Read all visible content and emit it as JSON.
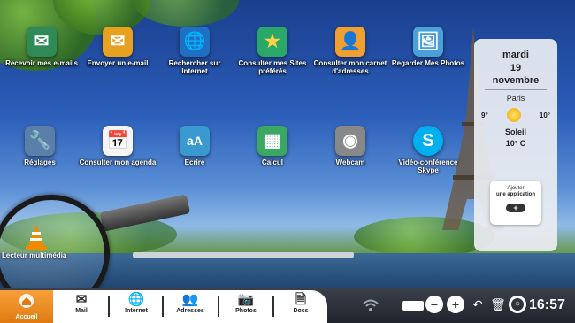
{
  "apps_row1": [
    {
      "label": "Recevoir mes e-mails",
      "icon": "receive-mail-icon",
      "glyph": "✉",
      "color": "#2e8b57"
    },
    {
      "label": "Envoyer un e-mail",
      "icon": "send-mail-icon",
      "glyph": "✉",
      "color": "#e8a020"
    },
    {
      "label": "Rechercher sur Internet",
      "icon": "globe-www-icon",
      "glyph": "🌐",
      "color": "#1f6fc2"
    },
    {
      "label": "Consulter mes Sites préférés",
      "icon": "favorites-globe-icon",
      "glyph": "★",
      "color": "#2aa86a"
    },
    {
      "label": "Consulter mon carnet d'adresses",
      "icon": "address-book-icon",
      "glyph": "👤",
      "color": "#f0a030"
    },
    {
      "label": "Regarder Mes Photos",
      "icon": "photos-icon",
      "glyph": "🖼",
      "color": "#4aa0d8"
    }
  ],
  "apps_row2": [
    {
      "label": "Réglages",
      "icon": "settings-tools-icon",
      "glyph": "🔧",
      "color": "#5a7fa8"
    },
    {
      "label": "Consulter mon agenda",
      "icon": "calendar-icon",
      "glyph": "📅",
      "color": "#d84040"
    },
    {
      "label": "Ecrire",
      "icon": "write-document-icon",
      "glyph": "aA",
      "color": "#3a9ad0"
    },
    {
      "label": "Calcul",
      "icon": "spreadsheet-icon",
      "glyph": "▦",
      "color": "#3aa860"
    },
    {
      "label": "Webcam",
      "icon": "webcam-icon",
      "glyph": "◉",
      "color": "#777777"
    },
    {
      "label": "Vidéo-conférence Skype",
      "icon": "skype-icon",
      "glyph": "S",
      "color": "#00aff0"
    }
  ],
  "date": {
    "weekday": "mardi",
    "day": "19",
    "month": "novembre"
  },
  "weather": {
    "city": "Paris",
    "low": "9°",
    "high": "10°",
    "condition": "Soleil",
    "current": "10° C"
  },
  "add_app": {
    "line1": "Ajouter",
    "line2": "une application",
    "plus": "+"
  },
  "magnifier_label": "Lecteur multimédia",
  "dock": [
    {
      "label": "Accueil",
      "icon": "home-icon"
    },
    {
      "label": "Mail",
      "icon": "mail-icon",
      "glyph": "✉"
    },
    {
      "label": "Internet",
      "icon": "globe-icon",
      "glyph": "🌐"
    },
    {
      "label": "Adresses",
      "icon": "contacts-icon",
      "glyph": "👥"
    },
    {
      "label": "Photos",
      "icon": "camera-icon",
      "glyph": "📷"
    },
    {
      "label": "Docs",
      "icon": "documents-icon",
      "glyph": "🗎"
    }
  ],
  "tray": {
    "clock": "16:57"
  }
}
